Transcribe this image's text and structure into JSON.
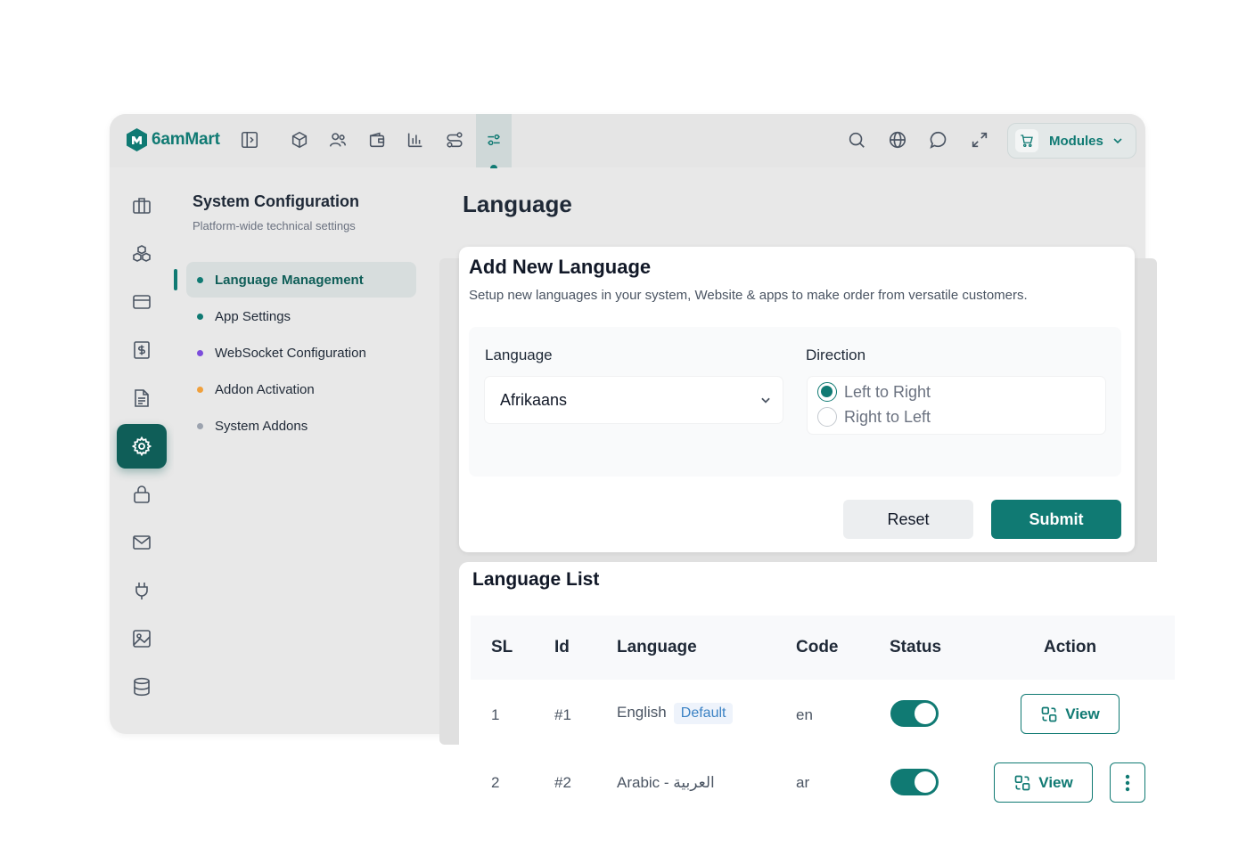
{
  "brand": {
    "name": "6amMart",
    "logo_letter": "M",
    "color": "#107a73"
  },
  "topbar": {
    "icons": [
      "sidebar-toggle-icon",
      "box-icon",
      "users-icon",
      "wallet-icon",
      "bar-chart-icon",
      "route-icon",
      "settings-sliders-icon"
    ],
    "right_icons": [
      "search-icon",
      "globe-icon",
      "chat-icon",
      "expand-icon"
    ],
    "modules_label": "Modules"
  },
  "icon_rail": [
    "briefcase-icon",
    "boxes-icon",
    "card-icon",
    "dollar-icon",
    "document-icon",
    "gear-icon",
    "lock-icon",
    "mail-icon",
    "plug-icon",
    "image-icon",
    "database-icon"
  ],
  "subnav": {
    "title": "System Configuration",
    "subtitle": "Platform-wide technical settings",
    "items": [
      {
        "label": "Language Management",
        "dot": "#107a73",
        "active": true
      },
      {
        "label": "App Settings",
        "dot": "#107a73",
        "active": false
      },
      {
        "label": "WebSocket Configuration",
        "dot": "#7c4ddb",
        "active": false
      },
      {
        "label": "Addon Activation",
        "dot": "#f0a03c",
        "active": false
      },
      {
        "label": "System Addons",
        "dot": "#9ca3af",
        "active": false
      }
    ]
  },
  "page": {
    "title": "Language"
  },
  "add_language": {
    "title": "Add New Language",
    "subtitle": "Setup new languages in your system, Website & apps to make order from versatile customers.",
    "language_label": "Language",
    "language_value": "Afrikaans",
    "direction_label": "Direction",
    "direction_options": [
      "Left to Right",
      "Right to Left"
    ],
    "direction_selected": "Left to Right",
    "reset_label": "Reset",
    "submit_label": "Submit"
  },
  "language_list": {
    "title": "Language List",
    "columns": [
      "SL",
      "Id",
      "Language",
      "Code",
      "Status",
      "Action"
    ],
    "rows": [
      {
        "sl": "1",
        "id": "#1",
        "language": "English",
        "badge": "Default",
        "code": "en",
        "status": true,
        "action": "View"
      },
      {
        "sl": "2",
        "id": "#2",
        "language": "Arabic - العربية",
        "badge": "",
        "code": "ar",
        "status": true,
        "action": "View"
      }
    ]
  }
}
